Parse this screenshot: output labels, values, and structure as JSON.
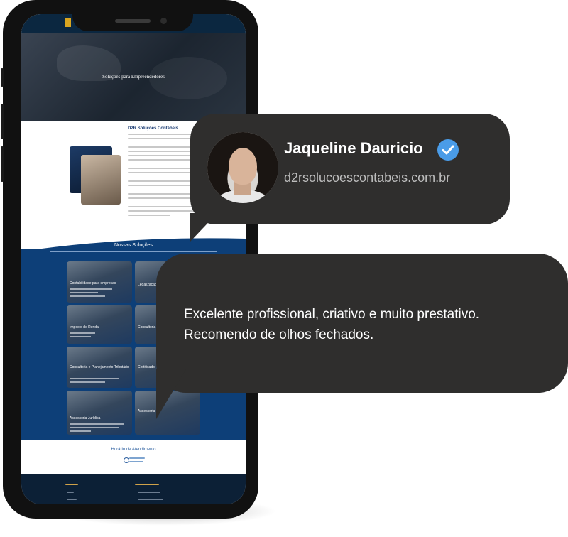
{
  "site": {
    "hero_title": "Soluções para Empreendedores",
    "about_title": "D2R Soluções Contábeis",
    "solutions_title": "Nossas Soluções",
    "cards": [
      {
        "label": "Contabilidade para empresas"
      },
      {
        "label": "Legalização"
      },
      {
        "label": "Imposto de Renda"
      },
      {
        "label": "Consultoria"
      },
      {
        "label": "Consultoria e Planejamento Tributário"
      },
      {
        "label": "Certificado"
      },
      {
        "label": "Assessoria Jurídica"
      },
      {
        "label": "Assessoria"
      }
    ],
    "schedule_title": "Horário de Atendimento"
  },
  "testimonial": {
    "name": "Jaqueline Dauricio",
    "domain": "d2rsolucoescontabeis.com.br",
    "review_line1": "Excelente profissional, criativo e muito prestativo.",
    "review_line2": "Recomendo de olhos fechados.",
    "verified_icon": "verified-check-icon",
    "verified_color": "#4a9ce8",
    "bubble_color": "#2f2e2d"
  }
}
